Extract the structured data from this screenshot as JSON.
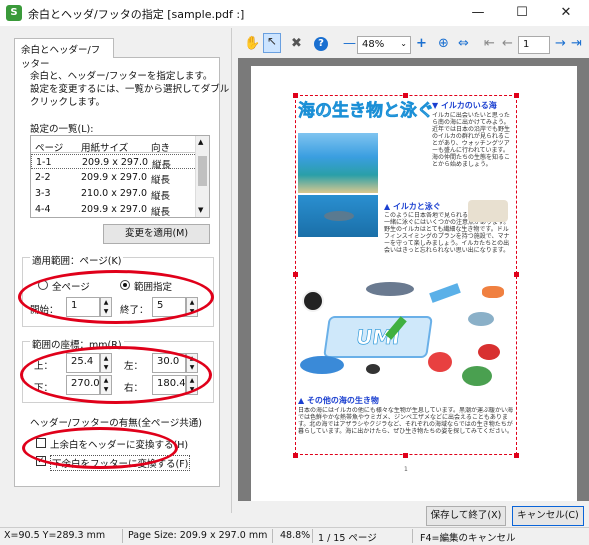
{
  "window": {
    "title": "余白とヘッダ/フッタの指定 [sample.pdf :]",
    "minimize": "—",
    "maximize": "☐",
    "close": "✕"
  },
  "tab": {
    "label": "余白とヘッダー/フッター"
  },
  "instructions": [
    "余白と、ヘッダー/フッターを指定します。",
    "設定を変更するには、一覧から選択してダブル",
    "クリックします。"
  ],
  "settings_list": {
    "label": "設定の一覧(L):",
    "headers": [
      "ページ",
      "用紙サイズ",
      "向き"
    ],
    "rows": [
      {
        "page": "1-1",
        "size": "209.9 x 297.0",
        "orient": "縦長"
      },
      {
        "page": "2-2",
        "size": "209.9 x 297.0",
        "orient": "縦長"
      },
      {
        "page": "3-3",
        "size": "210.0 x 297.0",
        "orient": "縦長"
      },
      {
        "page": "4-4",
        "size": "209.9 x 297.0",
        "orient": "縦長"
      }
    ]
  },
  "apply_button": "変更を適用(M)",
  "range": {
    "title": "適用範囲：ページ(K)",
    "all_pages": "全ページ",
    "specified": "範囲指定",
    "start_label": "開始：",
    "start_value": "1",
    "end_label": "終了：",
    "end_value": "5"
  },
  "margins": {
    "title": "範囲の座標：mm(R)",
    "top_label": "上：",
    "top_value": "25.4",
    "left_label": "左：",
    "left_value": "30.0",
    "bottom_label": "下：",
    "bottom_value": "270.0",
    "right_label": "右：",
    "right_value": "180.4"
  },
  "header_footer": {
    "title": "ヘッダー/フッターの有無(全ページ共通)",
    "header_check": "上余白をヘッダーに変換する(H)",
    "footer_check": "下余白をフッターに変換する(F)"
  },
  "toolbar": {
    "zoom": "48%",
    "page_input": "1"
  },
  "document": {
    "main_title": "海の生き物と泳ぐ",
    "section1": "▼ イルカのいる海",
    "section2": "▲ イルカと泳ぐ",
    "section3": "▲ その他の海の生き物",
    "logo_text": "UMI"
  },
  "footer_buttons": {
    "save": "保存して終了(X)",
    "cancel": "キャンセル(C)"
  },
  "status": {
    "coords": "X=90.5 Y=289.3 mm",
    "page_size": "Page Size: 209.9 x 297.0 mm",
    "zoom": "48.8%",
    "pages": "1 / 15 ページ",
    "hint": "F4=編集のキャンセル"
  },
  "colors": {
    "accent": "#0a64d8",
    "highlight": "#e0001a",
    "title_blue": "#1a8fd6"
  }
}
